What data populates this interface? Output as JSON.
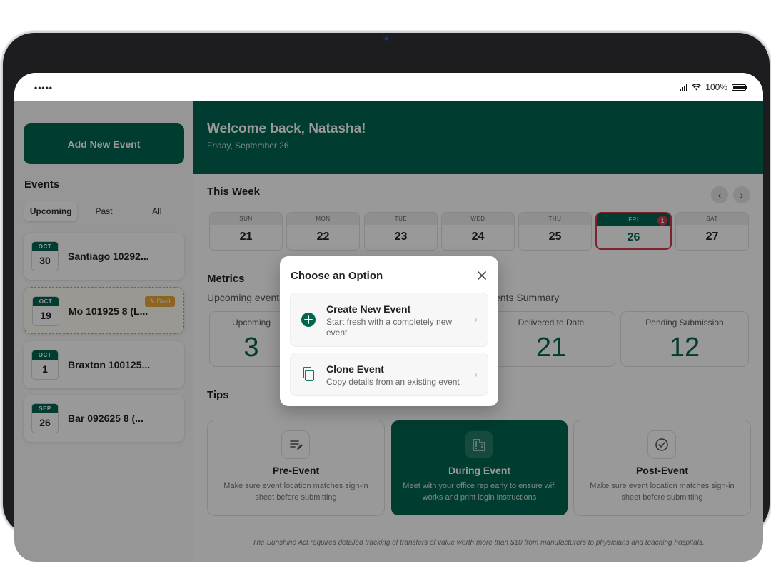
{
  "status": {
    "dots": "•••••",
    "battery": "100%"
  },
  "sidebar": {
    "add_button": "Add New Event",
    "events_title": "Events",
    "tabs": [
      "Upcoming",
      "Past",
      "All"
    ],
    "events": [
      {
        "month": "OCT",
        "day": "30",
        "name": "Santiago 10292..."
      },
      {
        "month": "OCT",
        "day": "19",
        "name": "Mo 101925 8 (L...",
        "badge": "✎ Draft"
      },
      {
        "month": "OCT",
        "day": "1",
        "name": "Braxton 100125..."
      },
      {
        "month": "SEP",
        "day": "26",
        "name": "Bar 092625 8 (..."
      }
    ]
  },
  "header": {
    "welcome": "Welcome back, Natasha!",
    "date": "Friday, September 26"
  },
  "week": {
    "title": "This Week",
    "days": [
      {
        "wd": "SUN",
        "num": "21"
      },
      {
        "wd": "MON",
        "num": "22"
      },
      {
        "wd": "TUE",
        "num": "23"
      },
      {
        "wd": "WED",
        "num": "24"
      },
      {
        "wd": "THU",
        "num": "25"
      },
      {
        "wd": "FRI",
        "num": "26",
        "badge": "1"
      },
      {
        "wd": "SAT",
        "num": "27"
      }
    ]
  },
  "metrics": {
    "title": "Metrics",
    "left_label": "Upcoming event",
    "right_label": "ents Summary",
    "cards": [
      {
        "label": "Upcoming",
        "value": "3"
      },
      {
        "label": "Delivered to Date",
        "value": "21"
      },
      {
        "label": "Pending Submission",
        "value": "12"
      }
    ]
  },
  "tips": {
    "title": "Tips",
    "cards": [
      {
        "title": "Pre-Event",
        "desc": "Make sure event location matches sign-in sheet before submitting",
        "icon": "notes-icon"
      },
      {
        "title": "During Event",
        "desc": "Meet with your office rep early to ensure wifi works and print login instructions",
        "icon": "building-icon"
      },
      {
        "title": "Post-Event",
        "desc": "Make sure event location matches sign-in sheet before submitting",
        "icon": "check-circle-icon"
      }
    ]
  },
  "footnote": "The Sunshine Act requires detailed tracking of transfers of value worth more than $10 from manufacturers to physicians and teaching hospitals.",
  "modal": {
    "title": "Choose an Option",
    "options": [
      {
        "title": "Create New Event",
        "desc": "Start fresh with a completely new event"
      },
      {
        "title": "Clone Event",
        "desc": "Copy details from an existing event"
      }
    ]
  },
  "colors": {
    "brand": "#00654f",
    "today": "#d23a4b",
    "draft": "#e9a93a"
  }
}
